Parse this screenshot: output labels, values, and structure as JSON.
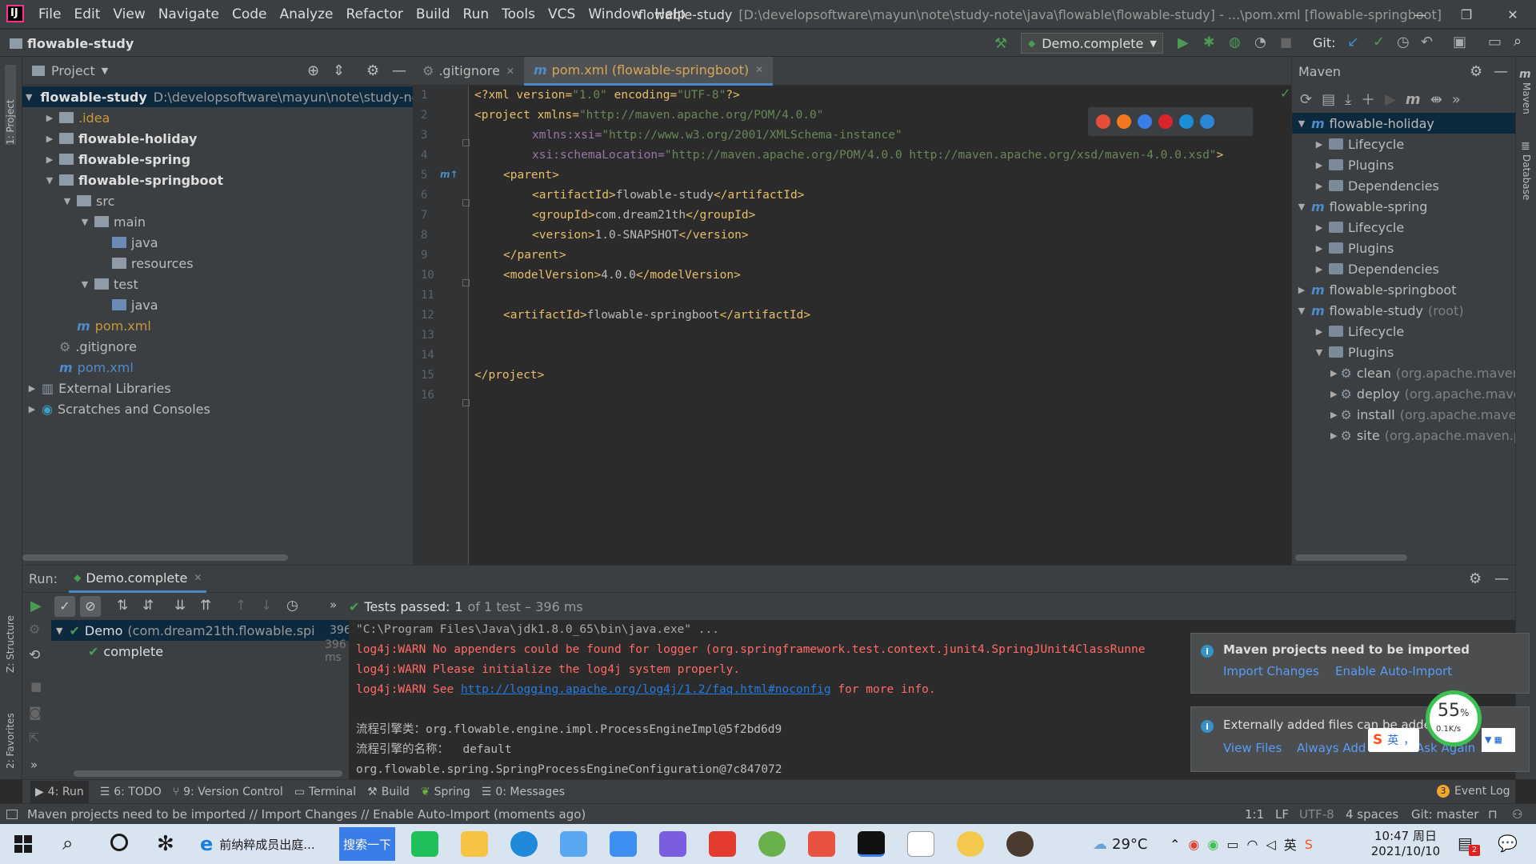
{
  "menubar": {
    "items": [
      "File",
      "Edit",
      "View",
      "Navigate",
      "Code",
      "Analyze",
      "Refactor",
      "Build",
      "Run",
      "Tools",
      "VCS",
      "Window",
      "Help"
    ],
    "title_project": "flowable-study",
    "title_rest": "[D:\\developsoftware\\mayun\\note\\study-note\\java\\flowable\\flowable-study] - ...\\pom.xml [flowable-springboot]"
  },
  "toolbar": {
    "breadcrumb": "flowable-study",
    "run_config": "Demo.complete",
    "git_label": "Git:"
  },
  "side_strips": {
    "project": "1: Project",
    "structure": "Z: Structure",
    "favorites": "2: Favorites",
    "maven": "Maven",
    "database": "Database"
  },
  "project": {
    "header": "Project",
    "items": [
      {
        "name": "flowable-study",
        "extra": "D:\\developsoftware\\mayun\\note\\study-note"
      },
      {
        "name": ".idea"
      },
      {
        "name": "flowable-holiday"
      },
      {
        "name": "flowable-spring"
      },
      {
        "name": "flowable-springboot"
      },
      {
        "name": "src"
      },
      {
        "name": "main"
      },
      {
        "name": "java"
      },
      {
        "name": "resources"
      },
      {
        "name": "test"
      },
      {
        "name": "java"
      },
      {
        "name": "pom.xml"
      },
      {
        "name": ".gitignore"
      },
      {
        "name": "pom.xml"
      },
      {
        "name": "External Libraries"
      },
      {
        "name": "Scratches and Consoles"
      }
    ]
  },
  "editor": {
    "tabs": [
      ".gitignore",
      "pom.xml (flowable-springboot)"
    ],
    "line_numbers": [
      "1",
      "2",
      "3",
      "4",
      "5",
      "6",
      "7",
      "8",
      "9",
      "10",
      "11",
      "12",
      "13",
      "14",
      "15",
      "16"
    ],
    "lines": [
      [
        "<?xml version=",
        "\"1.0\"",
        " encoding=",
        "\"UTF-8\"",
        "?>"
      ],
      [
        "<project xmlns=",
        "\"http://maven.apache.org/POM/4.0.0\""
      ],
      [
        "xmlns:xsi=",
        "\"http://www.w3.org/2001/XMLSchema-instance\""
      ],
      [
        "xsi:schemaLocation=",
        "\"http://maven.apache.org/POM/4.0.0 http://maven.apache.org/xsd/maven-4.0.0.xsd\"",
        ">"
      ],
      [
        "<parent>"
      ],
      [
        "<artifactId>",
        "flowable-study",
        "</artifactId>"
      ],
      [
        "<groupId>",
        "com.dream21th",
        "</groupId>"
      ],
      [
        "<version>",
        "1.0-SNAPSHOT",
        "</version>"
      ],
      [
        "</parent>"
      ],
      [
        "<modelVersion>",
        "4.0.0",
        "</modelVersion>"
      ],
      [
        ""
      ],
      [
        "<artifactId>",
        "flowable-springboot",
        "</artifactId>"
      ],
      [
        ""
      ],
      [
        ""
      ],
      [
        "</project>"
      ],
      [
        ""
      ]
    ],
    "browser_icons": [
      "chrome-icon",
      "firefox-icon",
      "safari-icon",
      "opera-icon",
      "ie-icon",
      "edge-icon"
    ]
  },
  "maven": {
    "header": "Maven",
    "items": [
      {
        "name": "flowable-holiday",
        "extra": ""
      },
      {
        "name": "Lifecycle",
        "extra": ""
      },
      {
        "name": "Plugins",
        "extra": ""
      },
      {
        "name": "Dependencies",
        "extra": ""
      },
      {
        "name": "flowable-spring",
        "extra": ""
      },
      {
        "name": "Lifecycle",
        "extra": ""
      },
      {
        "name": "Plugins",
        "extra": ""
      },
      {
        "name": "Dependencies",
        "extra": ""
      },
      {
        "name": "flowable-springboot",
        "extra": ""
      },
      {
        "name": "flowable-study",
        "extra": "(root)"
      },
      {
        "name": "Lifecycle",
        "extra": ""
      },
      {
        "name": "Plugins",
        "extra": ""
      },
      {
        "name": "clean",
        "extra": "(org.apache.maven."
      },
      {
        "name": "deploy",
        "extra": "(org.apache.mave"
      },
      {
        "name": "install",
        "extra": "(org.apache.maven"
      },
      {
        "name": "site",
        "extra": "(org.apache.maven.p"
      }
    ]
  },
  "run": {
    "label": "Run:",
    "tab": "Demo.complete",
    "tests_passed": "Tests passed:",
    "tests_count": "1",
    "tests_detail": "of 1 test – 396 ms",
    "tree": [
      {
        "name": "Demo",
        "pkg": "(com.dream21th.flowable.spi",
        "time": "396 ms"
      },
      {
        "name": "complete",
        "pkg": "",
        "time": "396 ms"
      }
    ],
    "console": [
      "\"C:\\Program Files\\Java\\jdk1.8.0_65\\bin\\java.exe\" ...",
      "log4j:WARN No appenders could be found for logger (org.springframework.test.context.junit4.SpringJUnit4ClassRunne",
      "log4j:WARN Please initialize the log4j system properly.",
      "log4j:WARN See ",
      "http://logging.apache.org/log4j/1.2/faq.html#noconfig",
      " for more info.",
      "流程引擎类：org.flowable.engine.impl.ProcessEngineImpl@5f2bd6d9",
      "流程引擎的名称：  default",
      "org.flowable.spring.SpringProcessEngineConfiguration@7c847072"
    ]
  },
  "notifications": {
    "n1_title": "Maven projects need to be imported",
    "n1_link1": "Import Changes",
    "n1_link2": "Enable Auto-Import",
    "n2_title": "Externally added files can be added",
    "n2_link1": "View Files",
    "n2_link2": "Always Add",
    "n2_link3": "Don't Ask Again"
  },
  "overlay": {
    "percent": "55",
    "percent_sign": "%",
    "speed": "0.1K/s",
    "ime": "英"
  },
  "bottom_tabs": [
    "4: Run",
    "6: TODO",
    "9: Version Control",
    "Terminal",
    "Build",
    "Spring",
    "0: Messages"
  ],
  "event_log": {
    "count": "3",
    "label": "Event Log"
  },
  "status": {
    "message": "Maven projects need to be imported // Import Changes // Enable Auto-Import (moments ago)",
    "position": "1:1",
    "line_sep": "LF",
    "encoding": "UTF-8",
    "indent": "4 spaces",
    "git": "Git: master"
  },
  "taskbar": {
    "browser_text": "前纳粹成员出庭...",
    "search_btn": "搜索一下",
    "weather": "29°C",
    "time": "10:47 周日",
    "date": "2021/10/10",
    "notif_count": "2"
  }
}
